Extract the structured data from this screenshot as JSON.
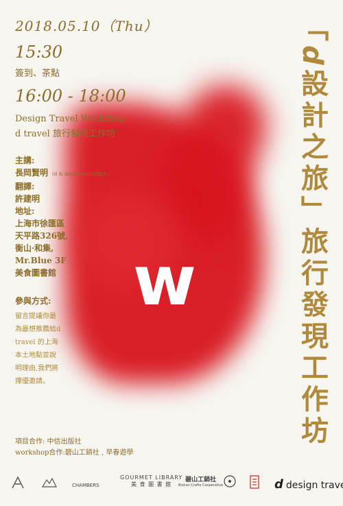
{
  "header": {
    "date": "2018.05.10（Thu）",
    "time1": "15:30",
    "time1_desc": "簽到、茶點",
    "time2": "16:00 - 18:00",
    "workshop_en": "Design Travel Workshop",
    "workshop_zh": "d travel 旅行發現工作坊"
  },
  "info": {
    "host_label": "主講:",
    "host": "長岡賢明",
    "host_note": "(d & department創始人)",
    "translator_label": "翻譯:",
    "translator": "許建明",
    "address_label": "地址:",
    "address_lines": [
      "上海市徐匯區",
      "天平路326號,",
      "衡山·和集,",
      "Mr.Blue 3F",
      "美食圖書館"
    ]
  },
  "participation": {
    "label": "參與方式:",
    "lines": [
      "留言提議你最",
      "為最想推薦給d",
      "travel 的上海",
      "本土地點並說",
      "明理由,我們將",
      "擇優邀請。"
    ]
  },
  "credits": {
    "line1": "項目合作: 中信出版社",
    "line2": "workshop合作:碧山工銷社 , 早春遊學"
  },
  "vertical_title": {
    "d_letter": "d",
    "text_part1": "「",
    "text_part2": "設計之旅」旅行發現工作坊"
  },
  "center_mark": "w",
  "logos": {
    "items": [
      "",
      "",
      "CHAMBERS",
      "GOURMET LIBRARY",
      "碧山工銷社",
      "",
      "",
      ""
    ],
    "gourmet_sub": "美 食 圖 書 館",
    "bishan_sub": "Bishan Crafts Cooperative",
    "dtravel_d": "d",
    "dtravel_text": "design travel"
  },
  "colors": {
    "gold": "#8d6d2a",
    "red": "#d8141d",
    "background": "#f7f5f0"
  }
}
